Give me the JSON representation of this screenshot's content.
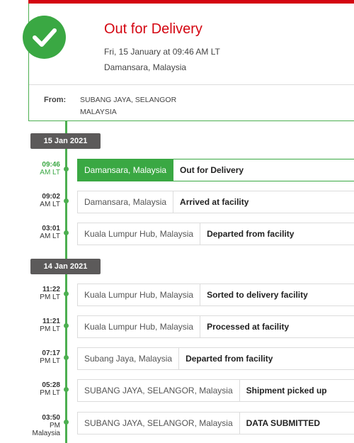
{
  "colors": {
    "brand_red": "#d40511",
    "green": "#3aa843",
    "badge_gray": "#5c5a5a"
  },
  "status": {
    "icon": "checkmark-icon",
    "title": "Out for Delivery",
    "datetime": "Fri, 15 January at 09:46 AM LT",
    "location": "Damansara, Malaysia",
    "from_label": "From:",
    "from_line1": "SUBANG JAYA, SELANGOR",
    "from_line2": "MALAYSIA"
  },
  "groups": [
    {
      "date": "15 Jan 2021",
      "events": [
        {
          "time": "09:46",
          "suffix": "AM LT",
          "location": "Damansara, Malaysia",
          "description": "Out for Delivery",
          "active": true
        },
        {
          "time": "09:02",
          "suffix": "AM LT",
          "location": "Damansara, Malaysia",
          "description": "Arrived at facility"
        },
        {
          "time": "03:01",
          "suffix": "AM LT",
          "location": "Kuala Lumpur Hub, Malaysia",
          "description": "Departed from facility"
        }
      ]
    },
    {
      "date": "14 Jan 2021",
      "events": [
        {
          "time": "11:22",
          "suffix": "PM LT",
          "location": "Kuala Lumpur Hub, Malaysia",
          "description": "Sorted to delivery facility"
        },
        {
          "time": "11:21",
          "suffix": "PM LT",
          "location": "Kuala Lumpur Hub, Malaysia",
          "description": "Processed at facility"
        },
        {
          "time": "07:17",
          "suffix": "PM LT",
          "location": "Subang Jaya, Malaysia",
          "description": "Departed from facility"
        },
        {
          "time": "05:28",
          "suffix": "PM LT",
          "location": "SUBANG JAYA, SELANGOR, Malaysia",
          "description": "Shipment picked up"
        },
        {
          "time": "03:50",
          "suffix": "PM Malaysia",
          "location": "SUBANG JAYA, SELANGOR, Malaysia",
          "description": "DATA SUBMITTED"
        }
      ]
    }
  ]
}
